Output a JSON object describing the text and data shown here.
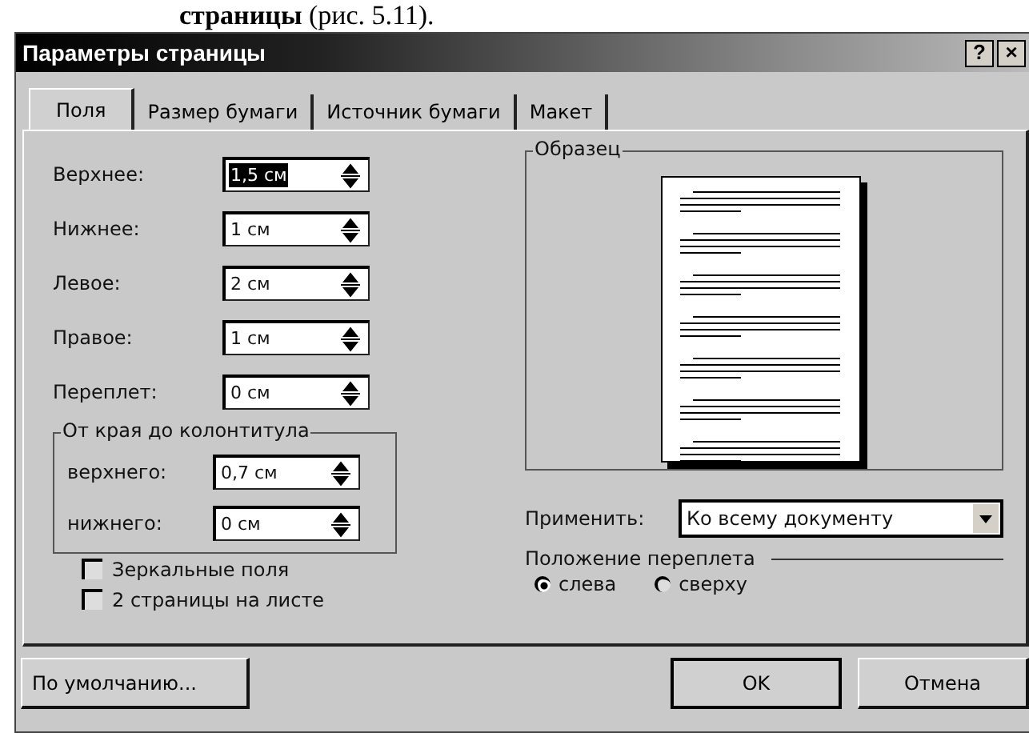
{
  "caption": "**страницы** (рис. 5.11).",
  "window": {
    "title": "Параметры страницы",
    "title_buttons": [
      "?",
      "×"
    ]
  },
  "tabs": [
    {
      "label": "Поля",
      "selected": true
    },
    {
      "label": "Размер бумаги",
      "selected": false
    },
    {
      "label": "Источник бумаги",
      "selected": false
    },
    {
      "label": "Макет",
      "selected": false
    }
  ],
  "margins": [
    {
      "label": "Верхнее:",
      "value": "1,5 см",
      "text_selected": true
    },
    {
      "label": "Нижнее:",
      "value": "1 см",
      "text_selected": false
    },
    {
      "label": "Левое:",
      "value": "2 см",
      "text_selected": false
    },
    {
      "label": "Правое:",
      "value": "1 см",
      "text_selected": false
    },
    {
      "label": "Переплет:",
      "value": "0 см",
      "text_selected": false
    }
  ],
  "header_group": {
    "title": "От края до колонтитула",
    "fields": [
      {
        "label": "верхнего:",
        "value": "0,7 см",
        "text_selected": false
      },
      {
        "label": "нижнего:",
        "value": "0 см",
        "text_selected": false
      }
    ]
  },
  "checkboxes": [
    {
      "label": "Зеркальные поля",
      "checked": false
    },
    {
      "label": "2 страницы на листе",
      "checked": false
    }
  ],
  "preview": {
    "title": "Образец"
  },
  "apply": {
    "label": "Применить:",
    "value": "Ко всему документу"
  },
  "gutter": {
    "title": "Положение переплета",
    "options": [
      {
        "label": "слева",
        "selected": true
      },
      {
        "label": "сверху",
        "selected": false
      }
    ]
  },
  "buttons": {
    "default": "По умолчанию...",
    "ok": "OK",
    "cancel": "Отмена"
  }
}
